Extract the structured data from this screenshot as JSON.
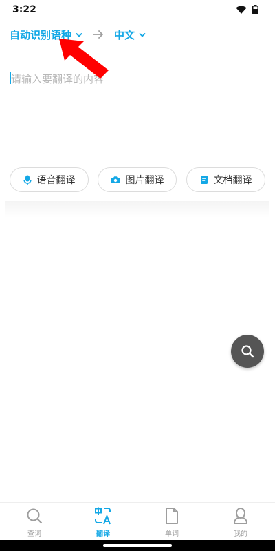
{
  "status_bar": {
    "time": "3:22"
  },
  "language_bar": {
    "source_language": "自动识别语种",
    "target_language": "中文"
  },
  "input": {
    "placeholder": "请输入要翻译的内容"
  },
  "modes": [
    {
      "label": "语音翻译",
      "icon": "microphone-icon"
    },
    {
      "label": "图片翻译",
      "icon": "camera-icon"
    },
    {
      "label": "文档翻译",
      "icon": "document-icon"
    }
  ],
  "bottom_nav": {
    "items": [
      {
        "label": "查词",
        "icon": "search-icon",
        "active": false
      },
      {
        "label": "翻译",
        "icon": "translate-icon",
        "active": true
      },
      {
        "label": "单词",
        "icon": "file-icon",
        "active": false
      },
      {
        "label": "我的",
        "icon": "user-icon",
        "active": false
      }
    ]
  },
  "colors": {
    "accent": "#14a8e6",
    "annotation_arrow": "#ff0000",
    "fab": "#555555",
    "inactive": "#9e9e9e"
  }
}
